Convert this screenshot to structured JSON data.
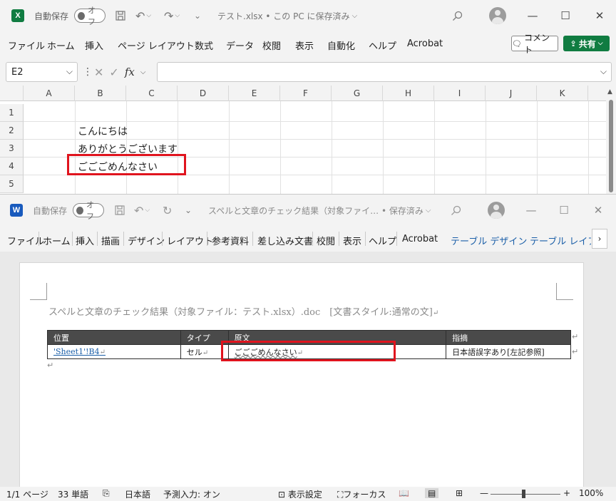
{
  "excel": {
    "logo": "X",
    "autosave_label": "自動保存",
    "autosave_state": "オフ",
    "file_title": "テスト.xlsx • この PC に保存済み",
    "tabs": [
      "ファイル",
      "ホーム",
      "挿入",
      "ページ レイアウト",
      "数式",
      "データ",
      "校閲",
      "表示",
      "自動化",
      "ヘルプ",
      "Acrobat"
    ],
    "comment_label": "コメント",
    "share_label": "共有",
    "namebox_value": "E2",
    "fx_label": "fx",
    "columns": [
      "A",
      "B",
      "C",
      "D",
      "E",
      "F",
      "G",
      "H",
      "I",
      "J",
      "K"
    ],
    "rows": [
      "1",
      "2",
      "3",
      "4",
      "5"
    ],
    "cells": {
      "b2": "こんにちは",
      "b3": "ありがとうございます",
      "b4": "ごごごめんなさい"
    }
  },
  "word": {
    "logo": "W",
    "autosave_label": "自動保存",
    "autosave_state": "オフ",
    "file_title": "スペルと文章のチェック結果（対象ファイ…  • 保存済み",
    "tabs": [
      "ファイル",
      "ホーム",
      "挿入",
      "描画",
      "デザイン",
      "レイアウト",
      "参考資料",
      "差し込み文書",
      "校閲",
      "表示",
      "ヘルプ",
      "Acrobat",
      "テーブル デザイン",
      "テーブル レイアウト"
    ],
    "doc_title": "スペルと文章のチェック結果（対象ファイル：テスト.xlsx）.doc　[文書スタイル:通常の文]",
    "table": {
      "headers": [
        "位置",
        "タイプ",
        "原文",
        "指摘"
      ],
      "row": [
        "'Sheet1'!B4",
        "セル",
        "ごごごめんなさい",
        "日本語誤字あり[左記参照]"
      ]
    },
    "status": {
      "page": "1/1 ページ",
      "words": "33 単語",
      "language": "日本語",
      "predict": "予測入力: オン",
      "display_settings": "表示設定",
      "focus": "フォーカス",
      "zoom": "100%"
    }
  },
  "colors": {
    "excel_green": "#107c41",
    "word_blue": "#185abd",
    "highlight_red": "#e0141e",
    "table_header": "#4a4a4a",
    "contextual_tab": "#1b5fa8"
  }
}
